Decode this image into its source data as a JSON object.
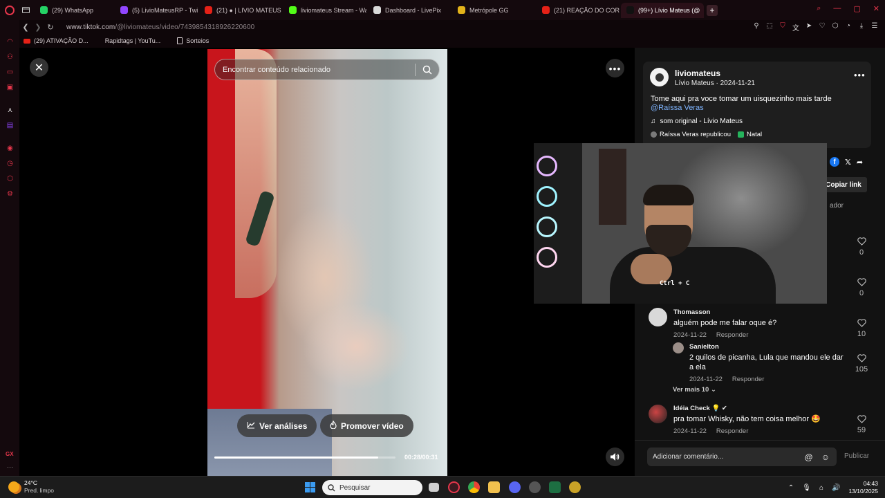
{
  "browser": {
    "tabs": [
      {
        "label": "(29) WhatsApp",
        "favicon_color": "#25d366",
        "active": false
      },
      {
        "label": "(5) LivioMateusRP - Twitc",
        "favicon_color": "#9146ff",
        "active": false
      },
      {
        "label": "(21) ● | LIVIO MATEUS |",
        "favicon_color": "#e62117",
        "active": false
      },
      {
        "label": "liviomateus Stream - Wate",
        "favicon_color": "#53fc18",
        "active": false
      },
      {
        "label": "Dashboard - LivePix",
        "favicon_color": "#d9d9d9",
        "active": false
      },
      {
        "label": "Metrópole GG",
        "favicon_color": "#e3b31a",
        "active": false
      },
      {
        "label": "(21) REAÇÃO DO CORONE",
        "favicon_color": "#e62117",
        "active": false
      },
      {
        "label": "(99+) Lívio Mateus (@",
        "favicon_color": "#111111",
        "active": true
      }
    ],
    "url_host": "www.tiktok.com",
    "url_path": "/@liviomateus/video/7439854318926220600",
    "bookmarks": [
      "(29) ATIVAÇÃO D...",
      "Rapidtags | YouTu...",
      "Sorteios"
    ],
    "sidebar_gx": "GX",
    "sidebar_more": "···"
  },
  "video": {
    "search_placeholder": "Encontrar conteúdo relacionado",
    "analytics_label": "Ver análises",
    "promote_label": "Promover vídeo",
    "time": "00:28/00:31",
    "progress": 0.903
  },
  "post": {
    "author": "liviomateus",
    "author_sub": "Lívio Mateus · 2024-11-21",
    "description": "Tome aqui pra voce tomar um uisquezinho mais tarde",
    "mention": "@Raíssa Veras",
    "music": "som original - Lívio Mateus",
    "repost_tag": "Raíssa Veras republicou",
    "topic_tag": "Natal",
    "copy_link_label": "Copiar link",
    "tab_fragment": "ador"
  },
  "likes_top": [
    "0",
    "0"
  ],
  "comments": [
    {
      "name": "Thomasson",
      "text": "alguém pode me falar oque é?",
      "date": "2024-11-22",
      "reply": "Responder",
      "likes": "10"
    },
    {
      "name": "Sanielton",
      "text": "2 quilos de picanha, Lula que mandou ele dar a ela",
      "date": "2024-11-22",
      "reply": "Responder",
      "likes": "105"
    },
    {
      "name": "Idéia Check 💡 ✔",
      "text": "pra tomar Whisky, não tem coisa melhor 🤩",
      "date": "2024-11-22",
      "reply": "Responder",
      "likes": "59"
    }
  ],
  "view_more": "Ver mais 10",
  "comment_bar": {
    "placeholder": "Adicionar comentário...",
    "publish": "Publicar"
  },
  "webcam": {
    "shirt_logo": "Ctrl + C"
  },
  "taskbar": {
    "temperature": "24°C",
    "weather": "Pred. limpo",
    "search": "Pesquisar",
    "time": "04:43",
    "date": "13/10/2025"
  },
  "colors": {
    "accent": "#e5364b",
    "link": "#7fb5ff",
    "panel_bg": "#121212"
  }
}
